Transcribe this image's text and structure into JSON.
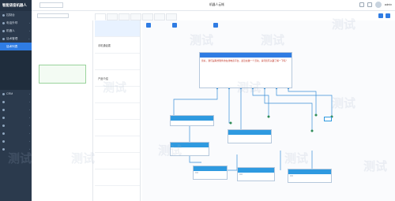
{
  "app": {
    "title": "智能语音机器人"
  },
  "sidebar": {
    "items": [
      {
        "label": "控制台"
      },
      {
        "label": "电话外呼"
      },
      {
        "label": "机器人"
      },
      {
        "label": "话术管理"
      },
      {
        "label": "话术列表"
      },
      {
        "label": ""
      },
      {
        "label": ""
      },
      {
        "label": ""
      },
      {
        "label": ""
      },
      {
        "label": ""
      },
      {
        "label": "CRM"
      },
      {
        "label": ""
      },
      {
        "label": ""
      },
      {
        "label": ""
      },
      {
        "label": ""
      },
      {
        "label": ""
      },
      {
        "label": ""
      },
      {
        "label": ""
      }
    ]
  },
  "header": {
    "breadcrumb": "",
    "select_value": "",
    "center_title": "机器人云帐",
    "user": "admin"
  },
  "toolbar": {
    "search_label": "",
    "btn1": "",
    "btn2": ""
  },
  "tabs": [
    {
      "label": ""
    },
    {
      "label": ""
    },
    {
      "label": ""
    },
    {
      "label": ""
    },
    {
      "label": ""
    },
    {
      "label": ""
    },
    {
      "label": ""
    }
  ],
  "card": {
    "title": "",
    "line1": "",
    "line2": ""
  },
  "node_list": [
    {
      "label": ""
    },
    {
      "label": "手机通话拨"
    },
    {
      "label": ""
    },
    {
      "label": "产品介绍"
    },
    {
      "label": ""
    },
    {
      "label": ""
    },
    {
      "label": ""
    },
    {
      "label": ""
    },
    {
      "label": ""
    },
    {
      "label": ""
    },
    {
      "label": ""
    }
  ],
  "canvas": {
    "main_node": {
      "header": "",
      "body": "您好，我们是联想软件的在线电商平台，最近在做一个活动，请问您有兴趣了解一下吗？"
    },
    "nodes": [
      {
        "header": "",
        "body": ""
      },
      {
        "header": "",
        "body": ""
      },
      {
        "header": "",
        "body": ""
      },
      {
        "header": "",
        "body": ""
      },
      {
        "header": "",
        "body": ""
      },
      {
        "header": "",
        "body": ""
      }
    ],
    "end_label": "",
    "chip_labels": [
      "",
      "",
      ""
    ]
  },
  "watermark": {
    "text": "测试"
  },
  "colors": {
    "sidebar": "#2b3a4d",
    "accent": "#2f7ce3",
    "node_header": "#2f9ae0",
    "card_border": "#9ad39c"
  }
}
